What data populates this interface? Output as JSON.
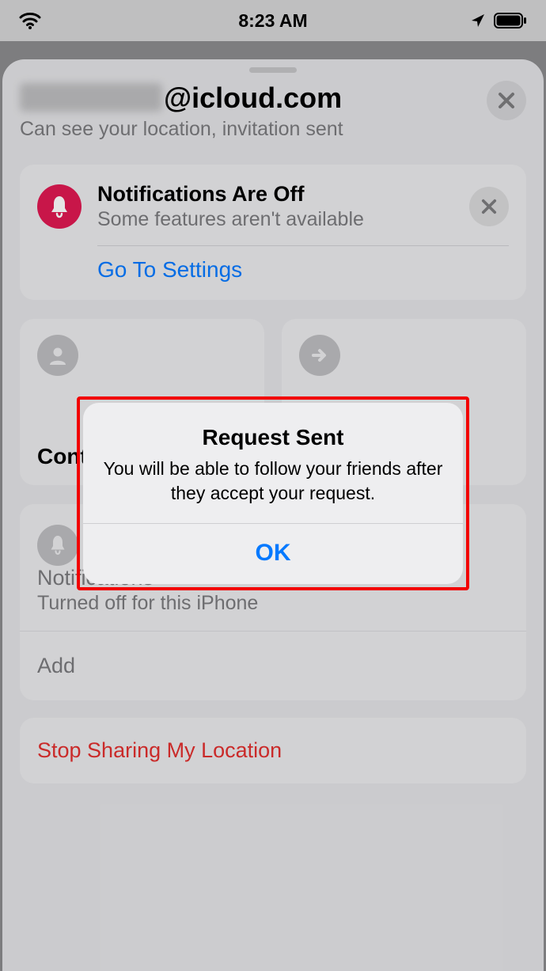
{
  "statusbar": {
    "time": "8:23 AM"
  },
  "header": {
    "email_suffix": "@icloud.com",
    "subtitle": "Can see your location, invitation sent"
  },
  "notif_card": {
    "title": "Notifications Are Off",
    "subtitle": "Some features aren't available",
    "link": "Go To Settings"
  },
  "tiles": {
    "left_label": "Contact",
    "right_label": "Directions"
  },
  "list": {
    "notifications_label": "Notifications",
    "notifications_sub": "Turned off for this iPhone",
    "add_label": "Add"
  },
  "stop": {
    "label": "Stop Sharing My Location"
  },
  "alert": {
    "title": "Request Sent",
    "message": "You will be able to follow your friends after they accept your request.",
    "ok": "OK"
  }
}
